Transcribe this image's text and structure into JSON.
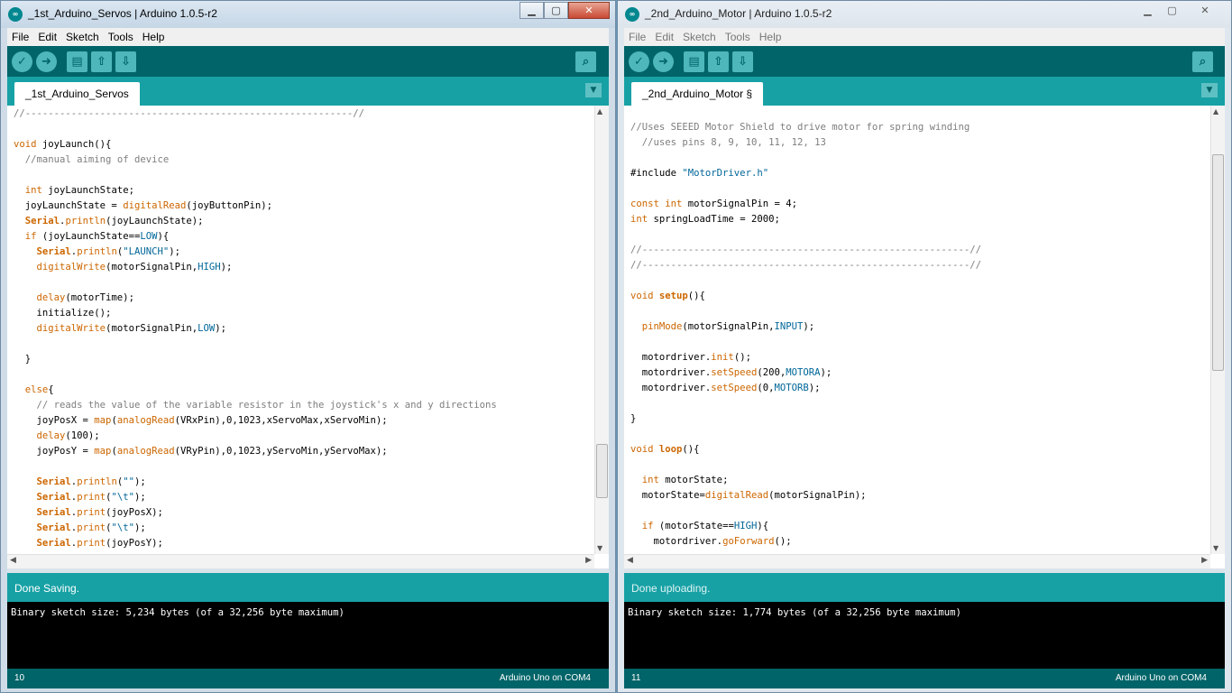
{
  "left": {
    "title": "_1st_Arduino_Servos | Arduino 1.0.5-r2",
    "menu": [
      "File",
      "Edit",
      "Sketch",
      "Tools",
      "Help"
    ],
    "tab": "_1st_Arduino_Servos",
    "status": "Done Saving.",
    "console": "Binary sketch size: 5,234 bytes (of a 32,256 byte maximum)",
    "line": "10",
    "board": "Arduino Uno on COM4"
  },
  "right": {
    "title": "_2nd_Arduino_Motor | Arduino 1.0.5-r2",
    "menu": [
      "File",
      "Edit",
      "Sketch",
      "Tools",
      "Help"
    ],
    "tab": "_2nd_Arduino_Motor §",
    "status": "Done uploading.",
    "console": "Binary sketch size: 1,774 bytes (of a 32,256 byte maximum)",
    "line": "11",
    "board": "Arduino Uno on COM4"
  },
  "icons": {
    "verify": "checkmark-icon",
    "upload": "arrow-right-icon",
    "new": "new-file-icon",
    "open": "open-up-arrow-icon",
    "save": "save-down-arrow-icon",
    "serial_monitor": "magnifier-icon",
    "tab_menu": "triangle-down-icon"
  },
  "colors": {
    "toolbar": "#006468",
    "tabbar": "#17a1a5",
    "keyword": "#cc6600",
    "constant": "#006699",
    "comment": "#7e7e7e"
  }
}
